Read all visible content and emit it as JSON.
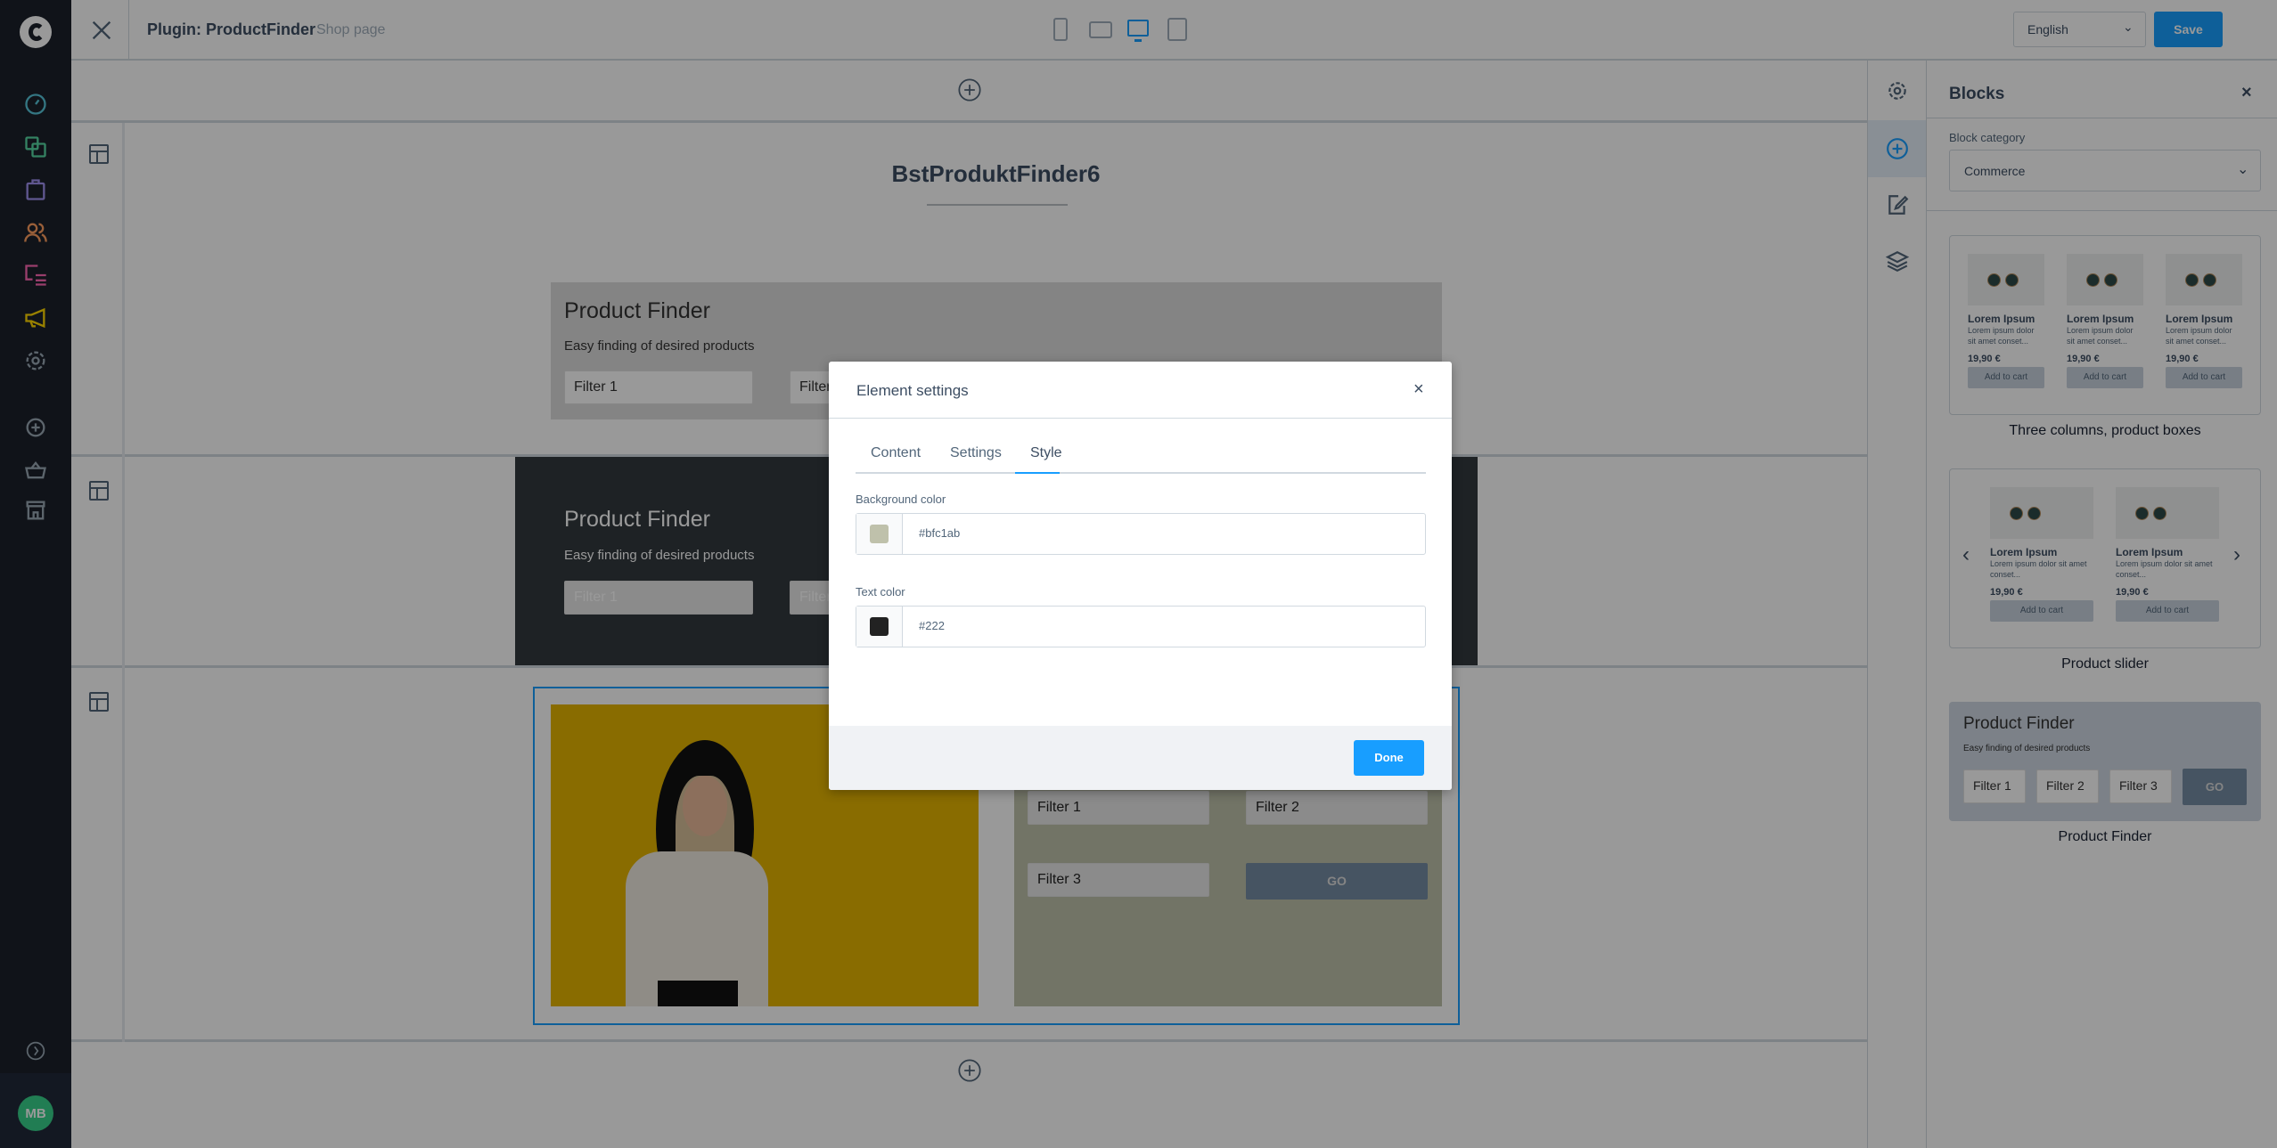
{
  "app": {
    "logo": "shopware-logo"
  },
  "sidebar": {
    "items": [
      {
        "icon": "dashboard-icon",
        "color": "#57d9a3"
      },
      {
        "icon": "catalog-icon",
        "color": "#57d9a3"
      },
      {
        "icon": "orders-icon",
        "color": "#a092f0"
      },
      {
        "icon": "customers-icon",
        "color": "#ff9e5f"
      },
      {
        "icon": "content-icon",
        "color": "#ff68b4"
      },
      {
        "icon": "marketing-icon",
        "color": "#ffd700"
      },
      {
        "icon": "settings-icon",
        "color": "#9aa8b5"
      }
    ],
    "secondary": [
      {
        "icon": "add-circle-icon"
      },
      {
        "icon": "basket-icon"
      },
      {
        "icon": "storefront-icon"
      }
    ],
    "avatar": "MB"
  },
  "header": {
    "title": "Plugin: ProductFinder",
    "subtitle": "Shop page",
    "language": "English",
    "save_label": "Save",
    "device_views": [
      "mobile",
      "tablet",
      "desktop",
      "form"
    ],
    "active_view": "desktop"
  },
  "canvas": {
    "page_title": "BstProduktFinder6",
    "section1": {
      "title": "Product Finder",
      "subtitle": "Easy finding of desired products",
      "filters": [
        "Filter 1",
        "Filter 2"
      ]
    },
    "section2": {
      "title": "Product Finder",
      "subtitle": "Easy finding of desired products",
      "filters": [
        "Filter 1",
        "Filter 2"
      ]
    },
    "section3": {
      "filters": [
        "Filter 1",
        "Filter 2",
        "Filter 3"
      ],
      "go_label": "GO",
      "panel_color": "#bfc1ab"
    }
  },
  "modal": {
    "title": "Element settings",
    "tabs": [
      {
        "label": "Content"
      },
      {
        "label": "Settings"
      },
      {
        "label": "Style",
        "active": true
      }
    ],
    "background_color": {
      "label": "Background color",
      "value": "#bfc1ab"
    },
    "text_color": {
      "label": "Text color",
      "value": "#222"
    },
    "done_label": "Done"
  },
  "blocks_panel": {
    "title": "Blocks",
    "category_label": "Block category",
    "category_value": "Commerce",
    "product": {
      "name": "Lorem Ipsum",
      "desc": "Lorem ipsum dolor sit amet conset...",
      "price": "19,90 €",
      "button": "Add to cart"
    },
    "blocks": [
      {
        "caption": "Three columns, product boxes"
      },
      {
        "caption": "Product slider"
      },
      {
        "caption": "Product Finder",
        "title": "Product Finder",
        "subtitle": "Easy finding of desired products",
        "filters": [
          "Filter 1",
          "Filter 2",
          "Filter 3"
        ],
        "go_label": "GO"
      }
    ]
  },
  "colors": {
    "accent": "#189eff",
    "sidebar_bg": "#1b202b",
    "selected_outline": "#189eff"
  }
}
